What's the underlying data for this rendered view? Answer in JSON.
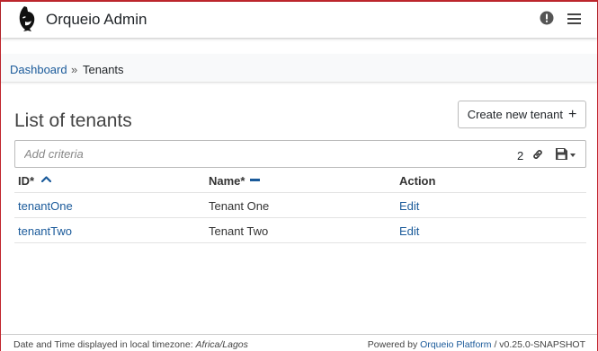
{
  "navbar": {
    "brand": "Orqueio Admin",
    "logo_icon": "orca-logo-icon",
    "alert_icon": "exclamation-circle-icon",
    "menu_icon": "hamburger-menu-icon"
  },
  "breadcrumb": {
    "dashboard": "Dashboard",
    "separator": "»",
    "current": "Tenants"
  },
  "page": {
    "title": "List of tenants",
    "create_button": "Create new tenant",
    "create_icon": "+"
  },
  "search": {
    "placeholder": "Add criteria",
    "count": "2",
    "link_icon": "link-icon",
    "save_icon": "floppy-disk-icon"
  },
  "table": {
    "headers": {
      "id": "ID*",
      "name": "Name*",
      "action": "Action"
    },
    "rows": [
      {
        "id": "tenantOne",
        "name": "Tenant One",
        "action": "Edit"
      },
      {
        "id": "tenantTwo",
        "name": "Tenant Two",
        "action": "Edit"
      }
    ]
  },
  "footer": {
    "timezone_prefix": "Date and Time displayed in local timezone:",
    "timezone": "Africa/Lagos",
    "powered_by": "Powered by",
    "platform_link": "Orqueio Platform",
    "version": "/ v0.25.0-SNAPSHOT"
  },
  "colors": {
    "accent": "#c0262d",
    "link": "#1a5a9a"
  }
}
